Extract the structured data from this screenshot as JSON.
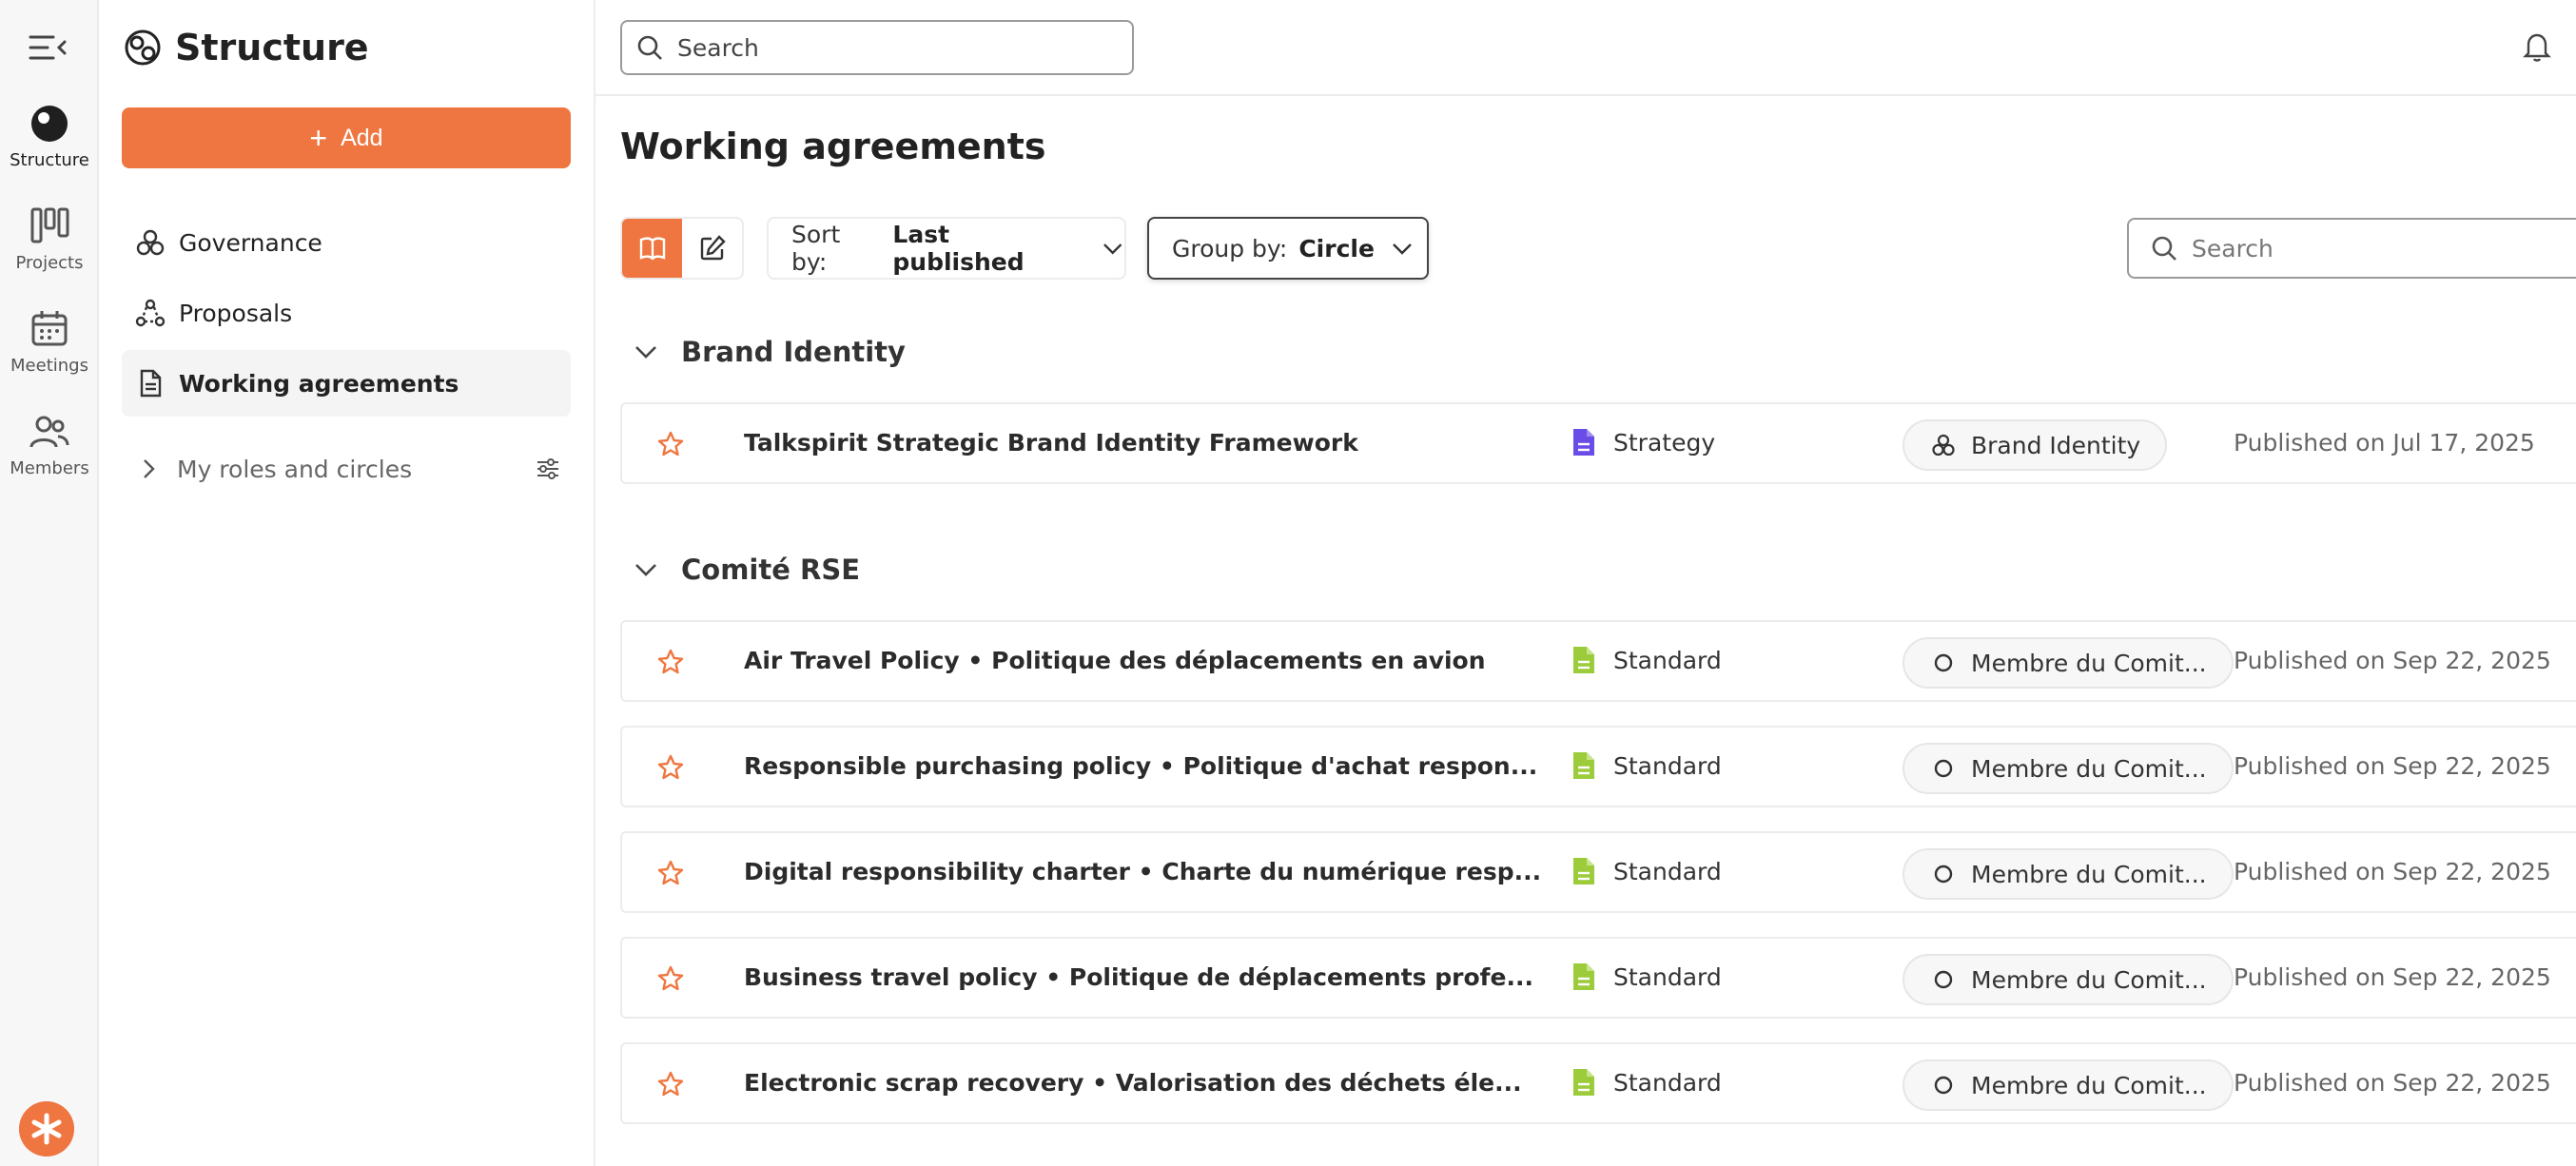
{
  "rail": {
    "items": [
      {
        "label": "Structure",
        "icon": "structure-icon",
        "active": true
      },
      {
        "label": "Projects",
        "icon": "projects-icon"
      },
      {
        "label": "Meetings",
        "icon": "meetings-icon"
      },
      {
        "label": "Members",
        "icon": "members-icon"
      }
    ]
  },
  "sidebar": {
    "title": "Structure",
    "add_label": "Add",
    "items": [
      {
        "label": "Governance",
        "icon": "governance-icon"
      },
      {
        "label": "Proposals",
        "icon": "proposals-icon"
      },
      {
        "label": "Working agreements",
        "icon": "document-icon",
        "active": true
      }
    ],
    "roles_label": "My roles and circles"
  },
  "topbar": {
    "search_placeholder": "Search"
  },
  "main": {
    "title": "Working agreements",
    "sort_label": "Sort by:",
    "sort_value": "Last published",
    "group_label": "Group by:",
    "group_value": "Circle",
    "search_placeholder": "Search",
    "groups": [
      {
        "name": "Brand Identity",
        "rows": [
          {
            "title": "Talkspirit Strategic Brand Identity Framework",
            "type": "Strategy",
            "circle": "Brand Identity",
            "published": "Published on Jul 17, 2025"
          }
        ]
      },
      {
        "name": "Comité RSE",
        "rows": [
          {
            "title": "Air Travel Policy • Politique des déplacements en avion",
            "type": "Standard",
            "circle": "Membre du Comit...",
            "published": "Published on Sep 22, 2025"
          },
          {
            "title": "Responsible purchasing policy • Politique d'achat respon...",
            "type": "Standard",
            "circle": "Membre du Comit...",
            "published": "Published on Sep 22, 2025"
          },
          {
            "title": "Digital responsibility charter • Charte du numérique resp...",
            "type": "Standard",
            "circle": "Membre du Comit...",
            "published": "Published on Sep 22, 2025"
          },
          {
            "title": "Business travel policy • Politique de déplacements profe...",
            "type": "Standard",
            "circle": "Membre du Comit...",
            "published": "Published on Sep 22, 2025"
          },
          {
            "title": "Electronic scrap recovery • Valorisation des déchets éle...",
            "type": "Standard",
            "circle": "Membre du Comit...",
            "published": "Published on Sep 22, 2025"
          }
        ]
      }
    ]
  },
  "colors": {
    "accent": "#ef7640",
    "strategy_doc": "#6a4de6",
    "standard_doc": "#9ccc3b"
  }
}
